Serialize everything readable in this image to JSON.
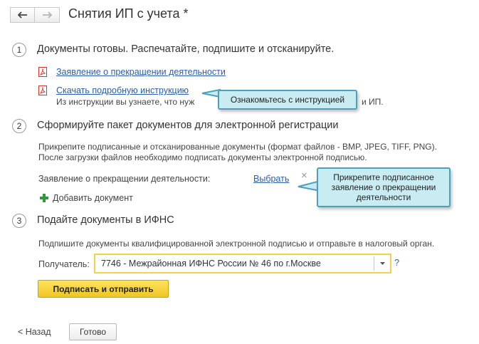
{
  "header": {
    "title": "Снятия ИП с учета *",
    "back_icon": "arrow-left-icon",
    "forward_icon": "arrow-right-icon"
  },
  "step1": {
    "number": "1",
    "title": "Документы готовы. Распечатайте, подпишите и отсканируйте.",
    "link1": "Заявление о прекращении деятельности",
    "link2": "Скачать подробную инструкцию",
    "note_left": "Из инструкции вы узнаете, что нуж",
    "note_right": "и ИП.",
    "callout": "Ознакомьтесь с инструкцией"
  },
  "step2": {
    "number": "2",
    "title": "Сформируйте пакет документов для электронной регистрации",
    "desc_line1": "Прикрепите подписанные и отсканированные документы (формат файлов - BMP, JPEG, TIFF, PNG).",
    "desc_line2": "После загрузки файлов необходимо подписать документы электронной подписью.",
    "field_label": "Заявление о прекращении деятельности:",
    "choose_link": "Выбрать",
    "clear_symbol": "×",
    "add_doc": "Добавить документ",
    "callout": "Прикрепите подписанное заявление о прекращении деятельности"
  },
  "step3": {
    "number": "3",
    "title": "Подайте документы в ИФНС",
    "desc": "Подпишите документы квалифицированной электронной подписью и отправьте в налоговый орган.",
    "recipient_label": "Получатель:",
    "recipient_value": "7746 - Межрайонная ИФНС России № 46 по г.Москве",
    "help": "?",
    "submit": "Подписать и отправить"
  },
  "footer": {
    "back": "< Назад",
    "done": "Готово"
  },
  "colors": {
    "accent_yellow": "#f2c524",
    "link_blue": "#2b5ea7",
    "callout_bg": "#c9ecf2",
    "callout_border": "#4ea0ba",
    "pdf_red": "#d9342b",
    "plus_green": "#2f9a3c"
  }
}
